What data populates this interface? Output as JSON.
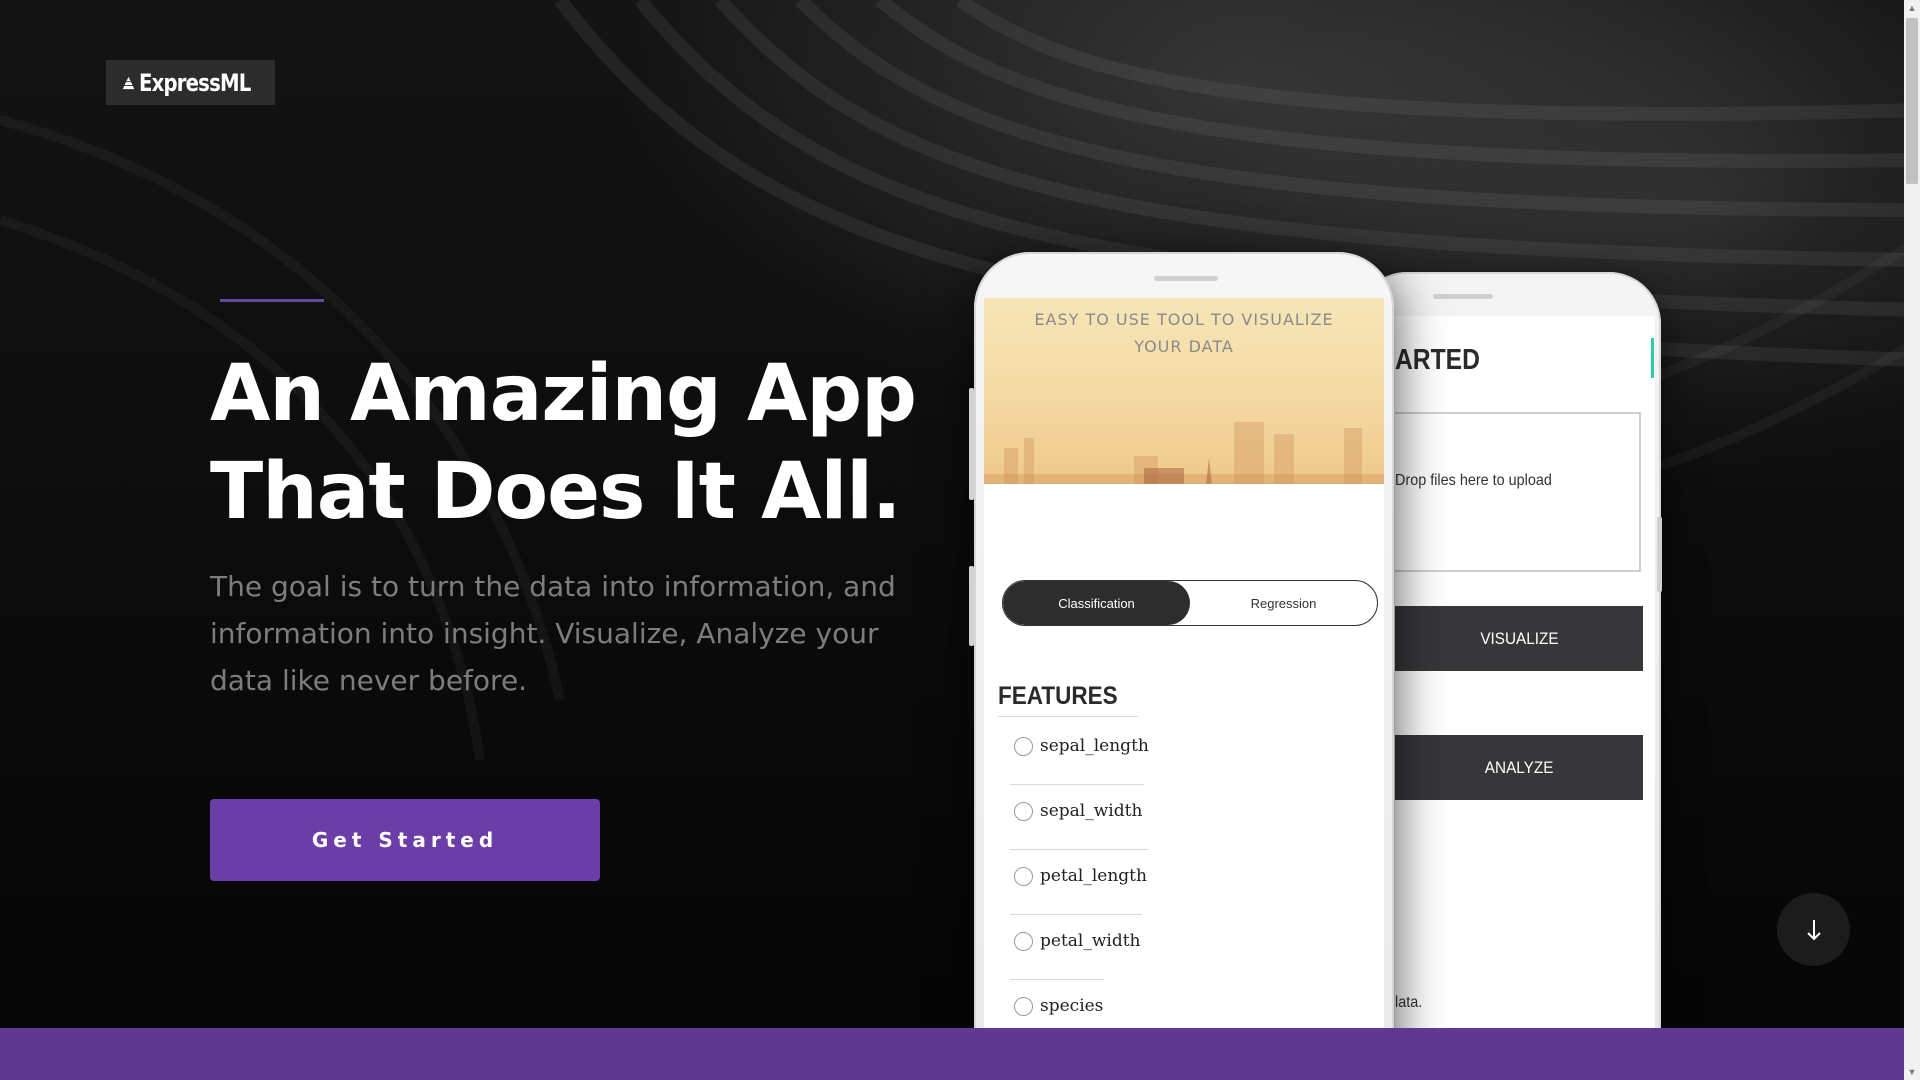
{
  "brand": {
    "name": "ExpressML",
    "logo_icon": "pyramid-icon"
  },
  "hero": {
    "headline_line1": "An Amazing App",
    "headline_line2": "That Does It All.",
    "subtext": "The goal is to turn the data into information, and information into insight. Visualize, Analyze your data like never before.",
    "cta_label": "Get Started",
    "accent_color": "#6a3ea6"
  },
  "scroll_down": {
    "icon": "arrow-down-icon",
    "glyph": "↓"
  },
  "phone_front": {
    "banner_text": "EASY TO USE TOOL TO VISUALIZE YOUR DATA",
    "toggle": {
      "options": [
        "Classification",
        "Regression"
      ],
      "selected": "Classification"
    },
    "features_title": "FEATURES",
    "features": [
      "sepal_length",
      "sepal_width",
      "petal_length",
      "petal_width",
      "species"
    ]
  },
  "phone_back": {
    "title_fragment": "ARTED",
    "dropzone_text": "Drop files here to upload",
    "visualize_label": "VISUALIZE",
    "analyze_label": "ANALYZE",
    "footnote_fragment": "lata."
  },
  "colors": {
    "band": "#5e3891",
    "button_dark": "#37373a",
    "accent_teal": "#2bd0a0"
  }
}
